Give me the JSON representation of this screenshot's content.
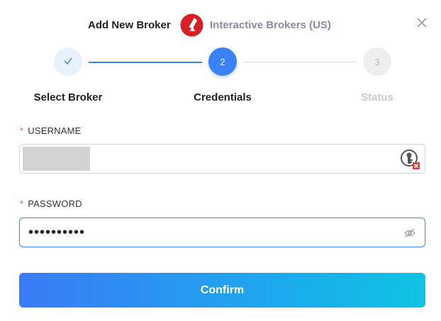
{
  "dialog": {
    "title": "Add New Broker",
    "broker_name": "Interactive Brokers (US)",
    "close_icon": "close-icon",
    "broker_logo_color": "#d81f26"
  },
  "stepper": {
    "steps": [
      {
        "number": "✓",
        "label": "Select Broker",
        "state": "completed"
      },
      {
        "number": "2",
        "label": "Credentials",
        "state": "active"
      },
      {
        "number": "3",
        "label": "Status",
        "state": "pending"
      }
    ],
    "accent": "#3b82f6"
  },
  "form": {
    "username": {
      "required_mark": "*",
      "label": "USERNAME",
      "value": "",
      "icon": "password-manager-key-icon"
    },
    "password": {
      "required_mark": "*",
      "label": "PASSWORD",
      "value": "••••••••••",
      "icon": "eye-off-icon"
    }
  },
  "actions": {
    "confirm_label": "Confirm"
  }
}
